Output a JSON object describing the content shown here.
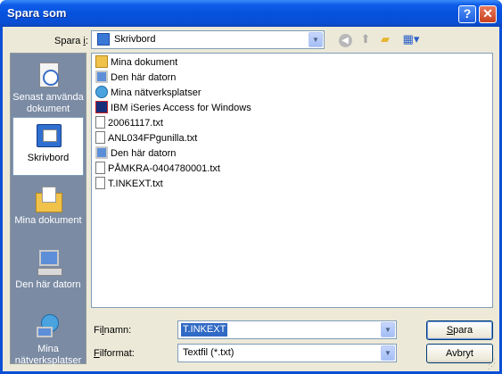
{
  "window": {
    "title": "Spara som",
    "help_label": "?",
    "close_label": "✕"
  },
  "toolbar": {
    "save_in_label_pre": "Spara ",
    "save_in_label_hot": "i",
    "save_in_label_post": ":",
    "location": "Skrivbord",
    "icons": [
      "back-icon",
      "up-folder-icon",
      "new-folder-icon",
      "views-menu-icon"
    ]
  },
  "places": [
    {
      "label": "Senast använda dokument",
      "icon": "recent-documents-icon"
    },
    {
      "label": "Skrivbord",
      "icon": "desktop-icon",
      "selected": true
    },
    {
      "label": "Mina dokument",
      "icon": "my-documents-icon"
    },
    {
      "label": "Den här datorn",
      "icon": "my-computer-icon"
    },
    {
      "label": "Mina nätverksplatser",
      "icon": "network-places-icon"
    }
  ],
  "files": [
    {
      "name": "Mina dokument",
      "icon": "folder-icon"
    },
    {
      "name": "Den här datorn",
      "icon": "computer-icon"
    },
    {
      "name": "Mina nätverksplatser",
      "icon": "network-icon"
    },
    {
      "name": "IBM iSeries Access for Windows",
      "icon": "ibm-app-icon"
    },
    {
      "name": "20061117.txt",
      "icon": "text-file-icon"
    },
    {
      "name": "ANL034FPgunilla.txt",
      "icon": "text-file-icon"
    },
    {
      "name": "Den här datorn",
      "icon": "computer-icon"
    },
    {
      "name": "PÅMKRA-0404780001.txt",
      "icon": "text-file-icon"
    },
    {
      "name": "T.INKEXT.txt",
      "icon": "text-file-icon"
    }
  ],
  "form": {
    "filename_label_pre": "Fi",
    "filename_label_hot": "l",
    "filename_label_post": "namn:",
    "filename_value": "T.INKEXT",
    "format_label_hot": "F",
    "format_label_post": "ilformat:",
    "format_value": "Textfil (*.txt)"
  },
  "buttons": {
    "save_hot": "S",
    "save_rest": "para",
    "cancel": "Avbryt"
  },
  "colors": {
    "title_bar": "#0552de",
    "selection": "#316ac5",
    "places_bar": "#7b8ba4",
    "dialog_face": "#ece9d8"
  }
}
